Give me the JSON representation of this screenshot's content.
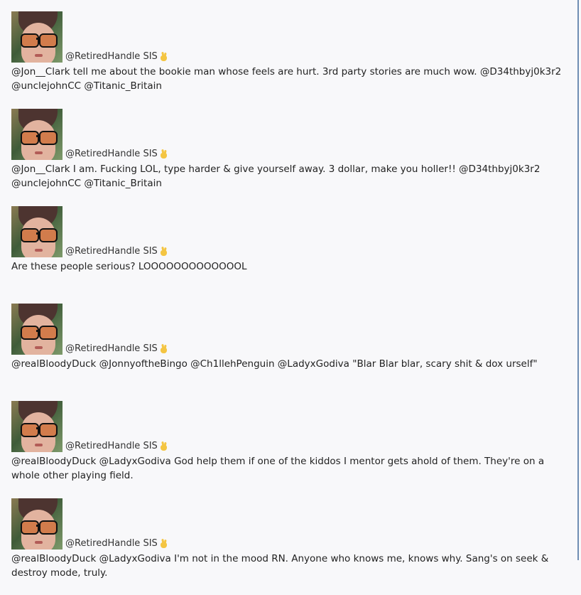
{
  "tweets": [
    {
      "handle": "@RetiredHandle SIS",
      "text": "@Jon__Clark tell me about the bookie man whose feels are hurt. 3rd party stories are much wow. @D34thbyj0k3r2 @unclejohnCC @Titanic_Britain"
    },
    {
      "handle": "@RetiredHandle SIS",
      "text": "@Jon__Clark I am. Fucking LOL, type harder & give yourself away. 3 dollar, make you holler!! @D34thbyj0k3r2 @unclejohnCC @Titanic_Britain"
    },
    {
      "handle": "@RetiredHandle SIS",
      "text": "Are these people serious? LOOOOOOOOOOOOOL"
    },
    {
      "handle": "@RetiredHandle SIS",
      "text": "@realBloodyDuck @JonnyoftheBingo @Ch1llehPenguin @LadyxGodiva \"Blar Blar blar, scary shit & dox urself\""
    },
    {
      "handle": "@RetiredHandle SIS",
      "text": "@realBloodyDuck @LadyxGodiva God help them if one of the kiddos I mentor gets ahold of them. They're on a whole other playing field."
    },
    {
      "handle": "@RetiredHandle SIS",
      "text": "@realBloodyDuck @LadyxGodiva I'm not in the mood RN. Anyone who knows me, knows why. Sang's on seek & destroy mode, truly."
    }
  ],
  "icons": {
    "avatar": "profile-photo",
    "badge": "victory-hand-icon"
  },
  "colors": {
    "background": "#f8f8fa",
    "border": "#6f8db3",
    "text": "#222222"
  }
}
